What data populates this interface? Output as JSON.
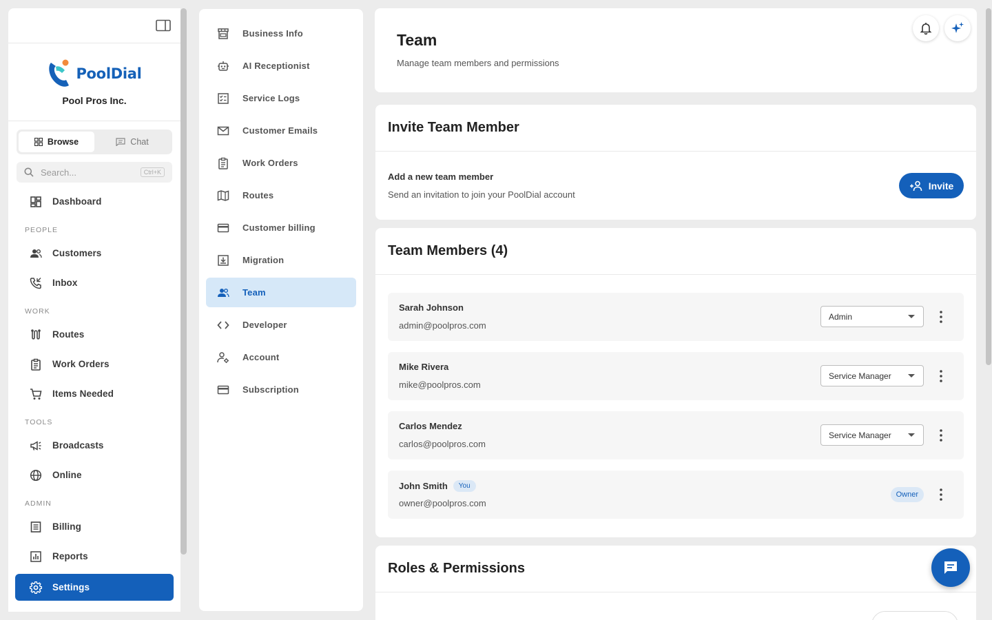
{
  "sidebar": {
    "brand": {
      "logo_text": "PoolDial",
      "org_name": "Pool Pros Inc."
    },
    "mode_toggle": {
      "browse": "Browse",
      "chat": "Chat",
      "active": "Browse"
    },
    "search": {
      "placeholder": "Search...",
      "shortcut": "Ctrl+K"
    },
    "items": {
      "dashboard": "Dashboard",
      "customers": "Customers",
      "inbox": "Inbox",
      "routes": "Routes",
      "work_orders": "Work Orders",
      "items_needed": "Items Needed",
      "broadcasts": "Broadcasts",
      "online": "Online",
      "billing": "Billing",
      "reports": "Reports",
      "settings": "Settings"
    },
    "sections": {
      "people": "PEOPLE",
      "work": "WORK",
      "tools": "TOOLS",
      "admin": "ADMIN"
    },
    "active_item": "Settings"
  },
  "settings_menu": {
    "items": [
      {
        "label": "Business Info",
        "icon": "storefront-icon"
      },
      {
        "label": "AI Receptionist",
        "icon": "robot-icon"
      },
      {
        "label": "Service Logs",
        "icon": "checklist-icon"
      },
      {
        "label": "Customer Emails",
        "icon": "envelope-icon"
      },
      {
        "label": "Work Orders",
        "icon": "clipboard-icon"
      },
      {
        "label": "Routes",
        "icon": "map-icon"
      },
      {
        "label": "Customer billing",
        "icon": "credit-card-icon"
      },
      {
        "label": "Migration",
        "icon": "import-icon"
      },
      {
        "label": "Team",
        "icon": "people-icon"
      },
      {
        "label": "Developer",
        "icon": "code-icon"
      },
      {
        "label": "Account",
        "icon": "user-gear-icon"
      },
      {
        "label": "Subscription",
        "icon": "credit-card-icon"
      }
    ],
    "active": "Team"
  },
  "header": {
    "title": "Team",
    "subtitle": "Manage team members and permissions"
  },
  "invite": {
    "heading": "Invite Team Member",
    "title": "Add a new team member",
    "subtitle": "Send an invitation to join your PoolDial account",
    "button": "Invite"
  },
  "team": {
    "heading": "Team Members (4)",
    "members": [
      {
        "name": "Sarah Johnson",
        "email": "admin@poolpros.com",
        "role": "Admin"
      },
      {
        "name": "Mike Rivera",
        "email": "mike@poolpros.com",
        "role": "Service Manager"
      },
      {
        "name": "Carlos Mendez",
        "email": "carlos@poolpros.com",
        "role": "Service Manager"
      },
      {
        "name": "John Smith",
        "email": "owner@poolpros.com",
        "role": "Owner",
        "you_badge": "You"
      }
    ]
  },
  "roles": {
    "heading": "Roles & Permissions"
  },
  "colors": {
    "primary": "#1460ba",
    "active_bg": "#d6e8f8",
    "background": "#ececec"
  }
}
